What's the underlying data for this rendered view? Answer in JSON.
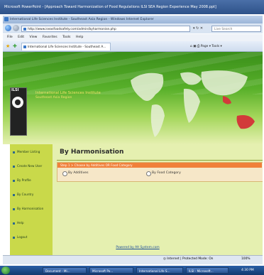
{
  "powerpoint": {
    "title": "Microsoft PowerPoint - [Approach Toward Harmonization of Food Regulations ILSI SEA Region Experience May 2008.ppt]"
  },
  "browser": {
    "title": "International Life Sciences Institute - Southeast Asia Region - Windows Internet Explorer",
    "address": "http://www.iseasfoodsafety.com/admin/byharmonise.php",
    "search_placeholder": "Live Search",
    "menu": [
      "File",
      "Edit",
      "View",
      "Favorites",
      "Tools",
      "Help"
    ],
    "tab_label": "International Life Sciences Institute - Southeast A...",
    "tools_label": "Page ▾  Tools ▾",
    "status_zone": "Internet | Protected Mode: On",
    "zoom": "100%"
  },
  "site": {
    "logo_text": "ILSI",
    "org_name": "International Life Sciences Institute",
    "region": "Southeast Asia Region"
  },
  "sidebar": {
    "items": [
      {
        "label": "Member Listing"
      },
      {
        "label": "Create New User"
      },
      {
        "label": "By Profile"
      },
      {
        "label": "By Country"
      },
      {
        "label": "By Harmonisation"
      },
      {
        "label": "Help"
      },
      {
        "label": "Logout"
      }
    ]
  },
  "main": {
    "title": "By Harmonisation",
    "step_text": "Step 1 > Choose by Additives OR Food Category",
    "option1": "By Additives",
    "option2": "By Food Category",
    "footer_link": "Powered by Alt System.com"
  },
  "taskbar": {
    "tasks": [
      "Document - Mi...",
      "Microsoft Po...",
      "International Life S...",
      "ILSI - Microsoft..."
    ],
    "clock": "4:30 PM"
  },
  "colors": {
    "banner_green": "#58b02a",
    "sidebar_green": "#c9d94a",
    "step_orange": "#f0803a",
    "title_text": "#f0e06a"
  }
}
